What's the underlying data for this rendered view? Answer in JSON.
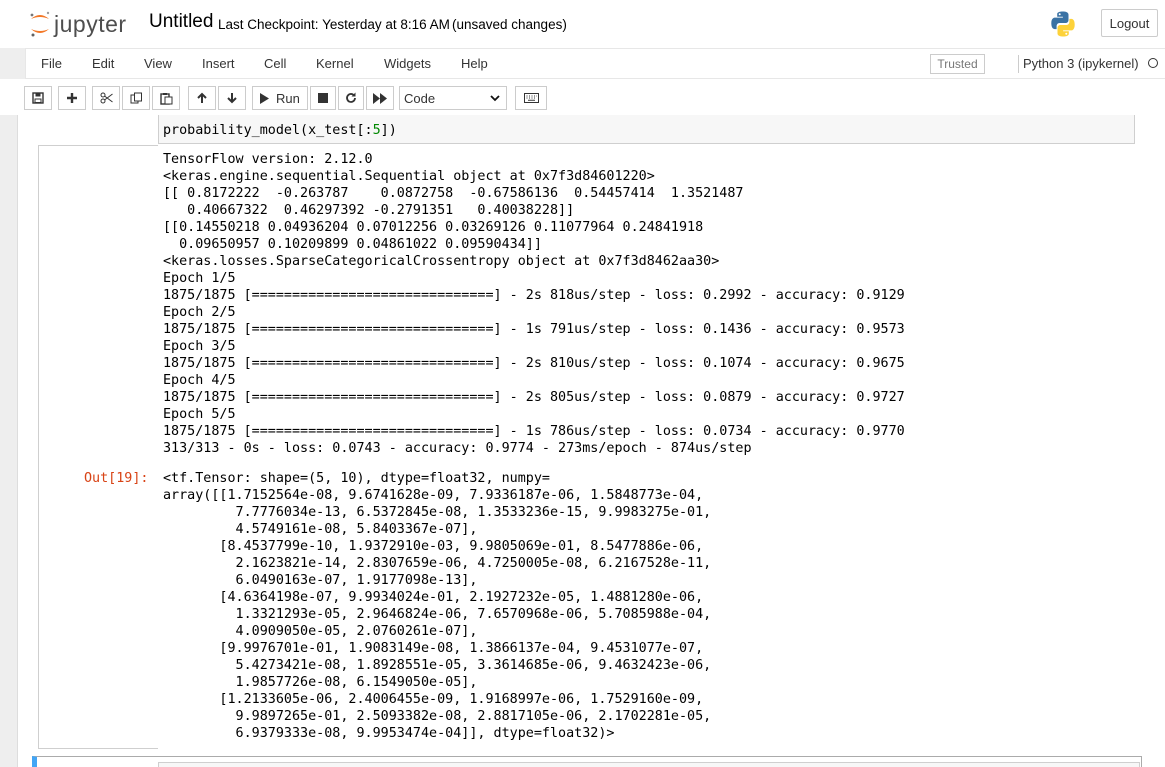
{
  "header": {
    "logo_text": "jupyter",
    "notebook_name": "Untitled",
    "checkpoint": "Last Checkpoint: Yesterday at 8:16 AM",
    "autosave_status": "(unsaved changes)",
    "logout_label": "Logout"
  },
  "menubar": {
    "items": [
      "File",
      "Edit",
      "View",
      "Insert",
      "Cell",
      "Kernel",
      "Widgets",
      "Help"
    ],
    "trusted_label": "Trusted",
    "kernel_name": "Python 3 (ipykernel)"
  },
  "toolbar": {
    "run_label": "Run",
    "cell_type": "Code",
    "icons": [
      "save-icon",
      "plus-icon",
      "cut-icon",
      "copy-icon",
      "paste-icon",
      "arrow-up-icon",
      "arrow-down-icon",
      "play-icon",
      "stop-icon",
      "restart-icon",
      "fast-forward-icon",
      "keyboard-icon"
    ]
  },
  "cell": {
    "input_code_prefix": "probability_model(x_test[:",
    "input_code_number": "5",
    "input_code_suffix": "])",
    "stream_output": "TensorFlow version: 2.12.0\n<keras.engine.sequential.Sequential object at 0x7f3d84601220>\n[[ 0.8172222  -0.263787    0.0872758  -0.67586136  0.54457414  1.3521487\n   0.40667322  0.46297392 -0.2791351   0.40038228]]\n[[0.14550218 0.04936204 0.07012256 0.03269126 0.11077964 0.24841918\n  0.09650957 0.10209899 0.04861022 0.09590434]]\n<keras.losses.SparseCategoricalCrossentropy object at 0x7f3d8462aa30>\nEpoch 1/5\n1875/1875 [==============================] - 2s 818us/step - loss: 0.2992 - accuracy: 0.9129\nEpoch 2/5\n1875/1875 [==============================] - 1s 791us/step - loss: 0.1436 - accuracy: 0.9573\nEpoch 3/5\n1875/1875 [==============================] - 2s 810us/step - loss: 0.1074 - accuracy: 0.9675\nEpoch 4/5\n1875/1875 [==============================] - 2s 805us/step - loss: 0.0879 - accuracy: 0.9727\nEpoch 5/5\n1875/1875 [==============================] - 1s 786us/step - loss: 0.0734 - accuracy: 0.9770\n313/313 - 0s - loss: 0.0743 - accuracy: 0.9774 - 273ms/epoch - 874us/step",
    "out_prompt": "Out[19]:",
    "result_output": "<tf.Tensor: shape=(5, 10), dtype=float32, numpy=\narray([[1.7152564e-08, 9.6741628e-09, 7.9336187e-06, 1.5848773e-04,\n         7.7776034e-13, 6.5372845e-08, 1.3533236e-15, 9.9983275e-01,\n         4.5749161e-08, 5.8403367e-07],\n       [8.4537799e-10, 1.9372910e-03, 9.9805069e-01, 8.5477886e-06,\n         2.1623821e-14, 2.8307659e-06, 4.7250005e-08, 6.2167528e-11,\n         6.0490163e-07, 1.9177098e-13],\n       [4.6364198e-07, 9.9934024e-01, 2.1927232e-05, 1.4881280e-06,\n         1.3321293e-05, 2.9646824e-06, 7.6570968e-06, 5.7085988e-04,\n         4.0909050e-05, 2.0760261e-07],\n       [9.9976701e-01, 1.9083149e-08, 1.3866137e-04, 9.4531077e-07,\n         5.4273421e-08, 1.8928551e-05, 3.3614685e-06, 9.4632423e-06,\n         1.9857726e-08, 6.1549050e-05],\n       [1.2133605e-06, 2.4006455e-09, 1.9168997e-06, 1.7529160e-09,\n         9.9897265e-01, 2.5093382e-08, 2.8817105e-06, 2.1702281e-05,\n         6.9379333e-08, 9.9953474e-04]], dtype=float32)>"
  },
  "colors": {
    "out_prompt": "#d84315",
    "selected_cell_border": "#42a5f5",
    "logo_orange": "#f37726",
    "number_literal": "#008800"
  }
}
